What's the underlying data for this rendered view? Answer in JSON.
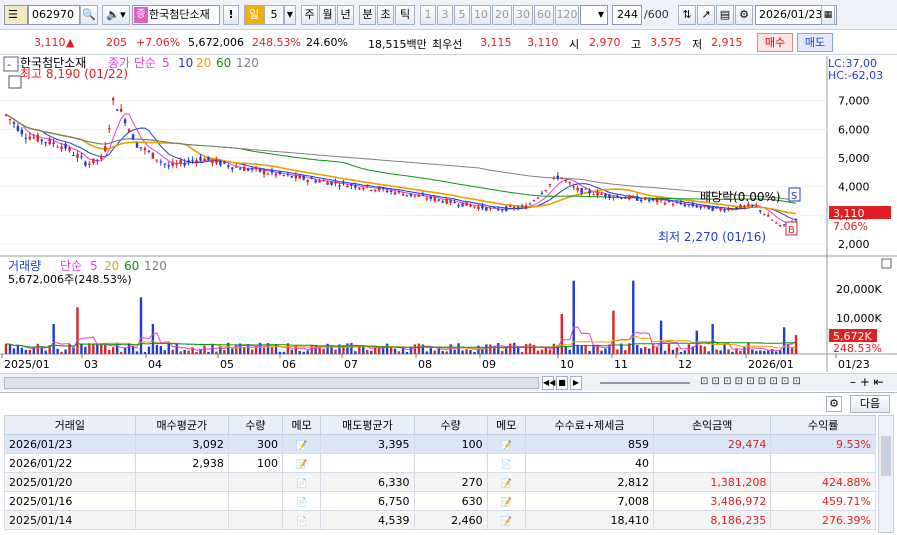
{
  "toolbar": {
    "code": "062970",
    "stock_name": "한국첨단소재",
    "period_value": "5",
    "period_unit": "일",
    "ranges": [
      "주",
      "월",
      "년",
      "분",
      "초",
      "틱"
    ],
    "ticks": [
      "1",
      "3",
      "5",
      "10",
      "20",
      "30",
      "60",
      "120"
    ],
    "count": "244",
    "count_max": "/600",
    "date": "2026/01/23"
  },
  "quote": {
    "price": "3,110",
    "change": "205",
    "change_pct": "+7.06%",
    "volume": "5,672,006",
    "volume_ratio": "248.53%",
    "turnover": "24.60%",
    "amount": "18,515백만",
    "preferred": "최우선",
    "bid1": "3,115",
    "ask1": "3,110",
    "open_label": "시",
    "open": "2,970",
    "high_label": "고",
    "high": "3,575",
    "low_label": "저",
    "low": "2,915",
    "buy_button": "매수",
    "sell_button": "매도"
  },
  "price_panel": {
    "name": "한국첨단소재",
    "ma_label": "종가 단순",
    "ma_periods": [
      "5",
      "10",
      "20",
      "60",
      "120"
    ],
    "high_note": "최고 8,190 (01/22)",
    "low_note": "최저 2,270 (01/16)",
    "dividend_note": "배당락(0.00%)",
    "lc": "LC:37,00",
    "hc": "HC:-62,03",
    "last_price": "3,110",
    "last_pct": "7.06%",
    "yticks": [
      "7,000",
      "6,000",
      "5,000",
      "4,000",
      "3,000",
      "2,000"
    ],
    "marker_s": "S",
    "marker_b": "B"
  },
  "volume_panel": {
    "title": "거래량",
    "ma_label": "단순",
    "ma_periods": [
      "5",
      "20",
      "60",
      "120"
    ],
    "value_note": "5,672,006주(248.53%)",
    "yticks": [
      "20,000K",
      "10,000K"
    ],
    "last_value": "5,672K",
    "last_pct": "248.53%"
  },
  "xaxis": [
    "2025/01",
    "03",
    "04",
    "05",
    "06",
    "07",
    "08",
    "09",
    "10",
    "11",
    "12",
    "2026/01",
    "01/23"
  ],
  "table": {
    "next_button": "다음",
    "headers": [
      "거래일",
      "매수평균가",
      "수량",
      "메모",
      "매도평균가",
      "수량",
      "메모",
      "수수료+제세금",
      "손익금액",
      "수익률"
    ],
    "rows": [
      [
        "2026/01/23",
        "3,092",
        "300",
        "",
        "3,395",
        "100",
        "",
        "859",
        "29,474",
        "9.53%"
      ],
      [
        "2026/01/22",
        "2,938",
        "100",
        "",
        "",
        "",
        "",
        "40",
        "",
        ""
      ],
      [
        "2025/01/20",
        "",
        "",
        "",
        "6,330",
        "270",
        "",
        "2,812",
        "1,381,208",
        "424.88%"
      ],
      [
        "2025/01/16",
        "",
        "",
        "",
        "6,750",
        "630",
        "",
        "7,008",
        "3,486,972",
        "459.71%"
      ],
      [
        "2025/01/14",
        "",
        "",
        "",
        "4,539",
        "2,460",
        "",
        "18,410",
        "8,186,235",
        "276.39%"
      ]
    ]
  },
  "colors": {
    "up": "#e02020",
    "down": "#1e3cd2",
    "ma5": "#e040e0",
    "ma10": "#1e3cd2",
    "ma20": "#e8a000",
    "ma60": "#109010",
    "ma120": "#808080"
  }
}
